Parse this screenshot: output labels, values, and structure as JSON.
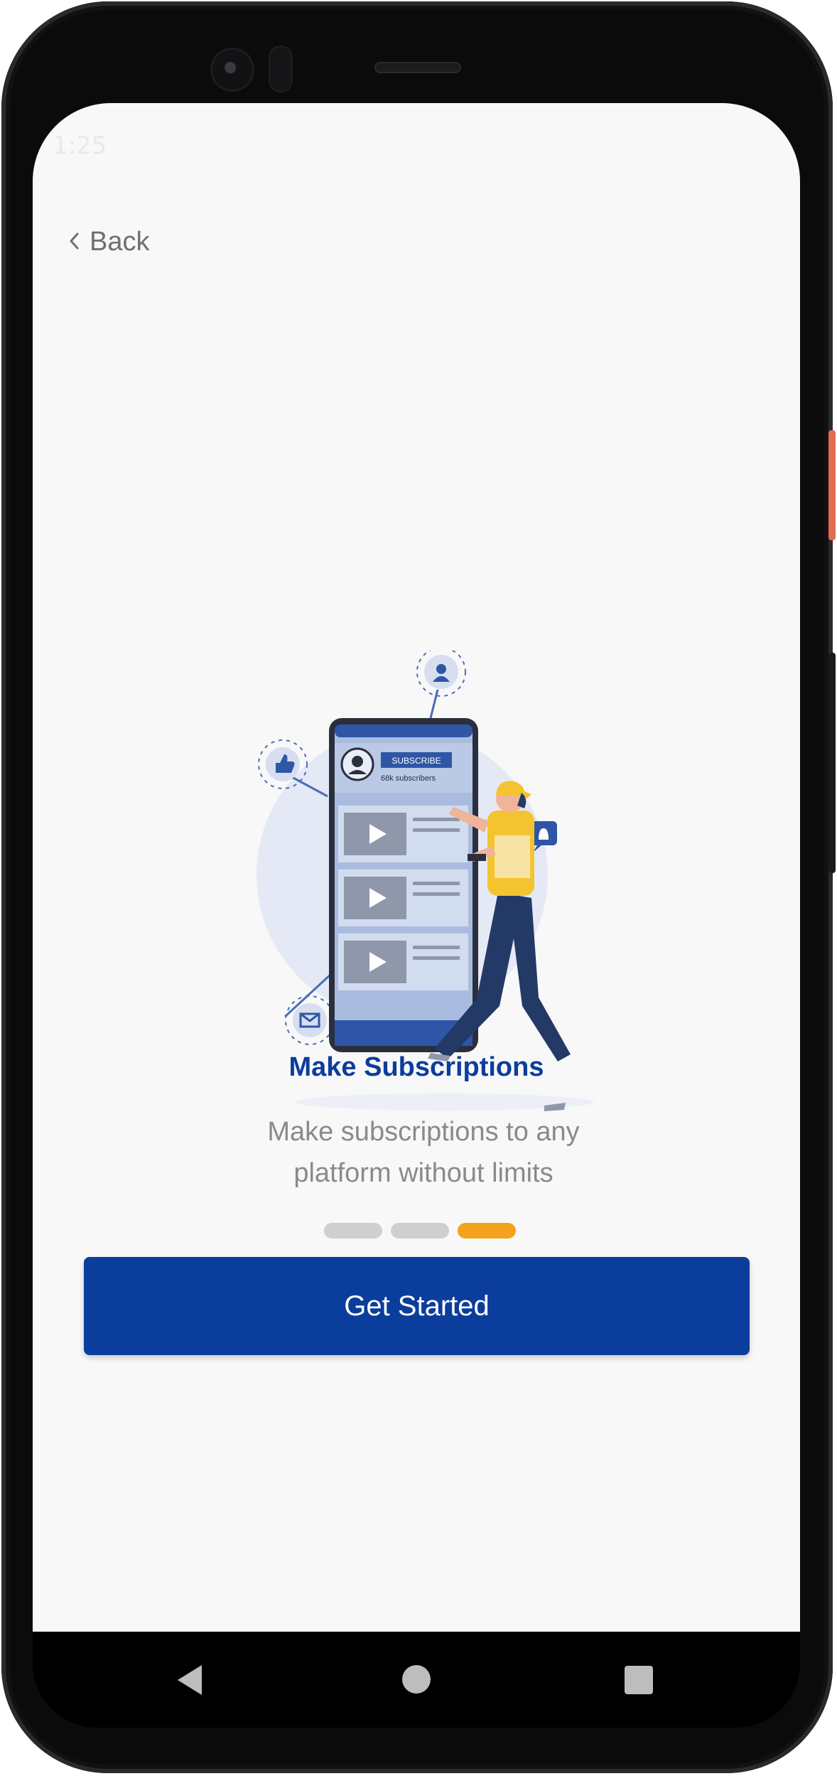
{
  "status_bar": {
    "time": "1:25"
  },
  "nav": {
    "back_label": "Back"
  },
  "onboarding": {
    "title": "Make Subscriptions",
    "description": "Make subscriptions to any platform without limits",
    "page_count": 3,
    "active_page": 3,
    "cta_label": "Get Started"
  },
  "illustration": {
    "subscribe_label": "SUBSCRIBE",
    "subscribers_label": "68k subscribers"
  },
  "colors": {
    "primary": "#0b3d9c",
    "accent": "#f4a11e",
    "background": "#f8f8f8",
    "text_muted": "#8a8a8a"
  },
  "system_nav": {
    "back": "back-icon",
    "home": "home-icon",
    "recents": "recents-icon"
  }
}
